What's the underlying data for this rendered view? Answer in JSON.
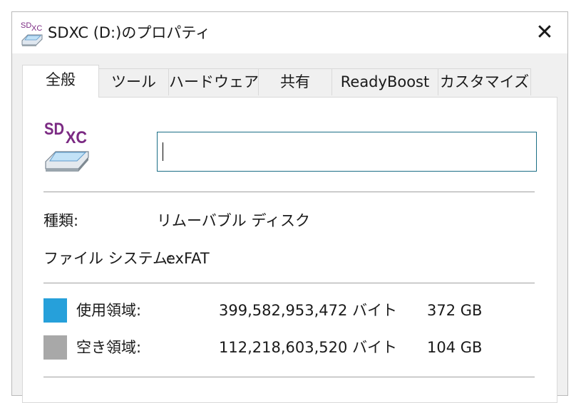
{
  "window": {
    "title": "SDXC (D:)のプロパティ",
    "close_glyph": "✕",
    "sd_logo_text_sd": "SD",
    "sd_logo_text_xc": "XC"
  },
  "tabs": [
    {
      "label": "全般",
      "active": true
    },
    {
      "label": "ツール",
      "active": false
    },
    {
      "label": "ハードウェア",
      "active": false
    },
    {
      "label": "共有",
      "active": false
    },
    {
      "label": "ReadyBoost",
      "active": false
    },
    {
      "label": "カスタマイズ",
      "active": false
    }
  ],
  "general": {
    "volume_name": "",
    "type_label": "種類:",
    "type_value": "リムーバブル ディスク",
    "fs_label": "ファイル システム:",
    "fs_value": "exFAT",
    "used": {
      "label": "使用領域:",
      "bytes": "399,582,953,472 バイト",
      "size": "372 GB",
      "color": "#26a0da"
    },
    "free": {
      "label": "空き領域:",
      "bytes": "112,218,603,520 バイト",
      "size": "104 GB",
      "color": "#a8a8a8"
    }
  },
  "icons": {
    "title": "sdxc-drive-icon",
    "drive": "sdxc-drive-icon",
    "close": "close-icon"
  },
  "colors": {
    "logo_purple": "#7b2a83",
    "input_border": "#1b6e86"
  }
}
